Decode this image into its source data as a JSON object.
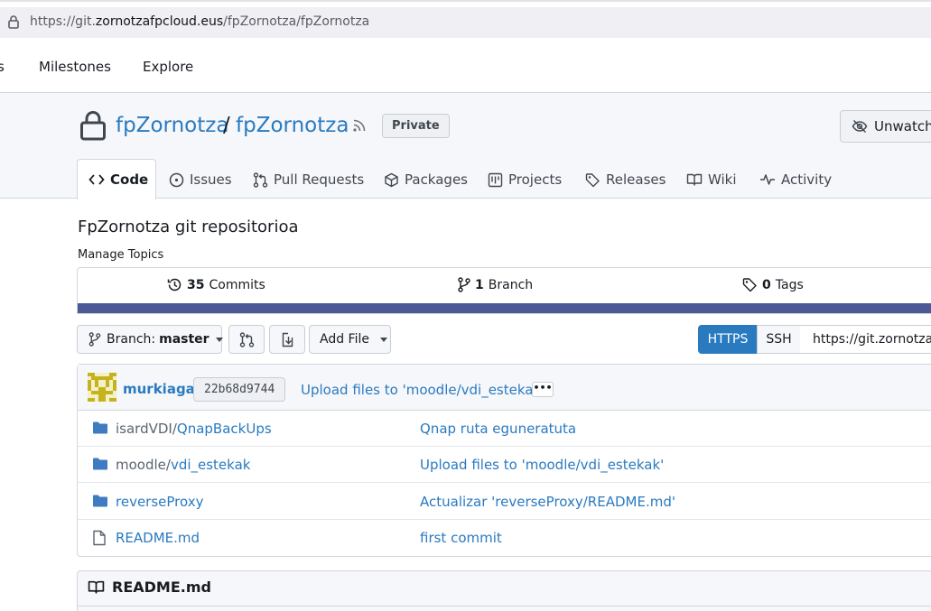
{
  "browser": {
    "url_prefix": "https://git.",
    "url_domain": "zornotzafpcloud.eus",
    "url_path": "/fpZornotza/fpZornotza"
  },
  "topnav": {
    "partial_item": "s",
    "items": [
      "Milestones",
      "Explore"
    ]
  },
  "repo": {
    "owner": "fpZornotza",
    "separator": "/",
    "name": "fpZornotza",
    "visibility_badge": "Private",
    "watch_label": "Unwatch",
    "description": "FpZornotza git repositorioa",
    "manage_topics": "Manage Topics"
  },
  "tabs": [
    {
      "label": "Code",
      "icon": "code-icon"
    },
    {
      "label": "Issues",
      "icon": "issue-opened-icon"
    },
    {
      "label": "Pull Requests",
      "icon": "git-pull-request-icon"
    },
    {
      "label": "Packages",
      "icon": "package-icon"
    },
    {
      "label": "Projects",
      "icon": "project-icon"
    },
    {
      "label": "Releases",
      "icon": "tag-icon"
    },
    {
      "label": "Wiki",
      "icon": "book-icon"
    },
    {
      "label": "Activity",
      "icon": "pulse-icon"
    }
  ],
  "stats": {
    "commits_count": "35",
    "commits_label": "Commits",
    "branch_count": "1",
    "branch_label": "Branch",
    "tags_count": "0",
    "tags_label": "Tags",
    "language_color": "#4b5a97"
  },
  "toolbar": {
    "branch_prefix": "Branch:",
    "branch_name": "master",
    "add_file_label": "Add File",
    "https_label": "HTTPS",
    "ssh_label": "SSH",
    "clone_url": "https://git.zornotzafpcloud.eus/fpZornotza/fpZornotza.git"
  },
  "latest_commit": {
    "author": "murkiaga",
    "sha": "22b68d9744",
    "message": "Upload files to 'moodle/vdi_estekak'",
    "more": "•••"
  },
  "files": [
    {
      "dir": "isardVDI/",
      "name": "QnapBackUps",
      "type": "folder",
      "message": "Qnap ruta eguneratuta"
    },
    {
      "dir": "moodle/",
      "name": "vdi_estekak",
      "type": "folder",
      "message": "Upload files to 'moodle/vdi_estekak'"
    },
    {
      "dir": "",
      "name": "reverseProxy",
      "type": "folder",
      "message": "Actualizar 'reverseProxy/README.md'"
    },
    {
      "dir": "",
      "name": "README.md",
      "type": "file",
      "message": "first commit"
    }
  ],
  "readme": {
    "title": "README.md"
  },
  "colors": {
    "link": "#2a7ac0",
    "primary_button": "#2a7ac0",
    "header_bg": "#f6f7fa"
  }
}
